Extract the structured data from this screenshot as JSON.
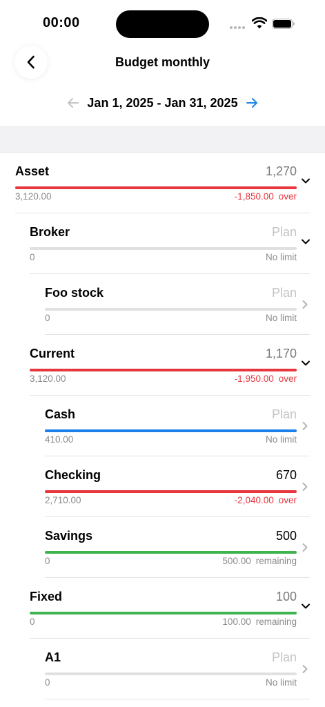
{
  "status_bar": {
    "time": "00:00"
  },
  "header": {
    "title": "Budget monthly"
  },
  "date_nav": {
    "range": "Jan 1, 2025 - Jan 31, 2025"
  },
  "colors": {
    "over": "#e8363f",
    "under": "#1a7fe8",
    "remaining": "#3fb34f",
    "empty": "#e0e0e0",
    "accent": "#1a86e8"
  },
  "rows": [
    {
      "name": "Asset",
      "level": 0,
      "amount": "1,270",
      "left": "3,120.00",
      "right_value": "-1,850.00",
      "right_status": "over",
      "bar": "over",
      "expand": "down"
    },
    {
      "name": "Broker",
      "level": 1,
      "amount": "Plan",
      "left": "0",
      "right_value": "",
      "right_status": "No limit",
      "bar": "empty",
      "expand": "down"
    },
    {
      "name": "Foo stock",
      "level": 2,
      "amount": "Plan",
      "left": "0",
      "right_value": "",
      "right_status": "No limit",
      "bar": "empty",
      "expand": "right"
    },
    {
      "name": "Current",
      "level": 1,
      "amount": "1,170",
      "left": "3,120.00",
      "right_value": "-1,950.00",
      "right_status": "over",
      "bar": "over",
      "expand": "down"
    },
    {
      "name": "Cash",
      "level": 2,
      "amount": "Plan",
      "left": "410.00",
      "right_value": "",
      "right_status": "No limit",
      "bar": "under",
      "expand": "right"
    },
    {
      "name": "Checking",
      "level": 2,
      "amount": "670",
      "left": "2,710.00",
      "right_value": "-2,040.00",
      "right_status": "over",
      "bar": "over",
      "expand": "right"
    },
    {
      "name": "Savings",
      "level": 2,
      "amount": "500",
      "left": "0",
      "right_value": "500.00",
      "right_status": "remaining",
      "bar": "remaining",
      "expand": "right"
    },
    {
      "name": "Fixed",
      "level": 1,
      "amount": "100",
      "left": "0",
      "right_value": "100.00",
      "right_status": "remaining",
      "bar": "remaining",
      "expand": "down"
    },
    {
      "name": "A1",
      "level": 2,
      "amount": "Plan",
      "left": "0",
      "right_value": "",
      "right_status": "No limit",
      "bar": "empty",
      "expand": "right"
    }
  ]
}
